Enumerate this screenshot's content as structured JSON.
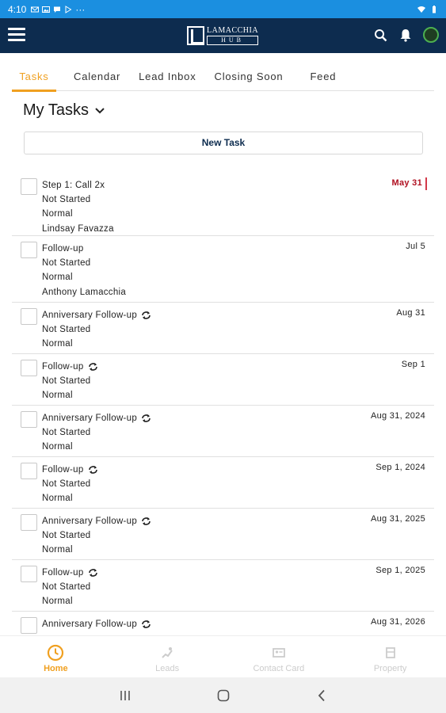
{
  "status_bar": {
    "time": "4:10",
    "more": "···"
  },
  "app": {
    "logo_line1": "LAMACCHIA",
    "logo_line2": "HUB"
  },
  "tabs": [
    {
      "label": "Tasks",
      "active": true
    },
    {
      "label": "Calendar",
      "active": false
    },
    {
      "label": "Lead Inbox",
      "active": false
    },
    {
      "label": "Closing Soon",
      "active": false
    },
    {
      "label": "Feed",
      "active": false
    }
  ],
  "section": {
    "title": "My Tasks"
  },
  "new_task_label": "New Task",
  "tasks": [
    {
      "title": "Step 1: Call 2x",
      "status": "Not Started",
      "priority": "Normal",
      "assignee": "Lindsay Favazza",
      "date": "May 31",
      "overdue": true,
      "recurring": false
    },
    {
      "title": "Follow-up",
      "status": "Not Started",
      "priority": "Normal",
      "assignee": "Anthony Lamacchia",
      "date": "Jul 5",
      "overdue": false,
      "recurring": false
    },
    {
      "title": "Anniversary Follow-up",
      "status": "Not Started",
      "priority": "Normal",
      "assignee": "",
      "date": "Aug 31",
      "overdue": false,
      "recurring": true
    },
    {
      "title": "Follow-up",
      "status": "Not Started",
      "priority": "Normal",
      "assignee": "",
      "date": "Sep 1",
      "overdue": false,
      "recurring": true
    },
    {
      "title": "Anniversary Follow-up",
      "status": "Not Started",
      "priority": "Normal",
      "assignee": "",
      "date": "Aug 31, 2024",
      "overdue": false,
      "recurring": true
    },
    {
      "title": "Follow-up",
      "status": "Not Started",
      "priority": "Normal",
      "assignee": "",
      "date": "Sep 1, 2024",
      "overdue": false,
      "recurring": true
    },
    {
      "title": "Anniversary Follow-up",
      "status": "Not Started",
      "priority": "Normal",
      "assignee": "",
      "date": "Aug 31, 2025",
      "overdue": false,
      "recurring": true
    },
    {
      "title": "Follow-up",
      "status": "Not Started",
      "priority": "Normal",
      "assignee": "",
      "date": "Sep 1, 2025",
      "overdue": false,
      "recurring": true
    },
    {
      "title": "Anniversary Follow-up",
      "status": "",
      "priority": "",
      "assignee": "",
      "date": "Aug 31, 2026",
      "overdue": false,
      "recurring": true
    }
  ],
  "bottom_nav": [
    {
      "label": "Home",
      "icon": "clock-icon",
      "active": true
    },
    {
      "label": "Leads",
      "icon": "leads-icon",
      "active": false
    },
    {
      "label": "Contact Card",
      "icon": "contact-card-icon",
      "active": false
    },
    {
      "label": "Property",
      "icon": "property-icon",
      "active": false
    }
  ],
  "colors": {
    "accent": "#f0a020",
    "appbar": "#0d2c4f",
    "statusbar": "#1b8fe0",
    "overdue": "#b01020"
  }
}
